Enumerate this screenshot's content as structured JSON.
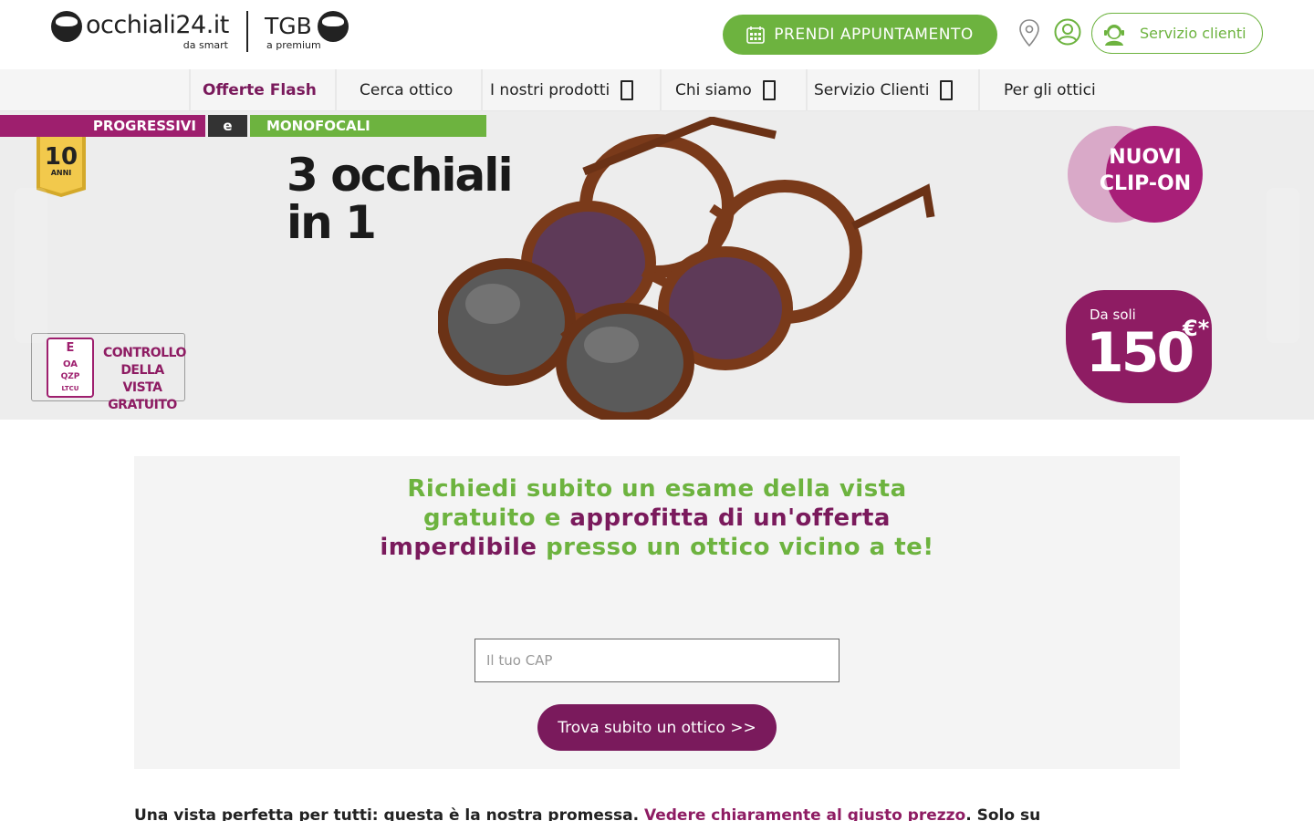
{
  "header": {
    "logo_occhiali": {
      "name": "occhiali24.it",
      "sub": "da smart"
    },
    "logo_tgb": {
      "name": "TGB",
      "sub": "a premium"
    },
    "appointment_label": "PRENDI APPUNTAMENTO",
    "service_label": "Servizio clienti",
    "accent_green": "#6db33f",
    "accent_purple": "#7a1a5c"
  },
  "nav": {
    "items": [
      {
        "label": "Offerte Flash"
      },
      {
        "label": "Cerca ottico"
      },
      {
        "label": "I nostri prodotti"
      },
      {
        "label": "Chi siamo"
      },
      {
        "label": "Servizio Clienti"
      },
      {
        "label": "Per gli ottici"
      }
    ]
  },
  "banner": {
    "pill_progressivi": "PROGRESSIVI",
    "pill_e": "e",
    "pill_monofocali": "MONOFOCALI",
    "badge_years": "10",
    "badge_anni": "ANNI",
    "headline_line1": "3 occhiali",
    "headline_line2": "in 1",
    "clipon_line1": "NUOVI",
    "clipon_line2": "CLIP-ON",
    "price_prefix": "Da soli",
    "price_value": "150",
    "price_currency": "€*",
    "controllo_line1": "CONTROLLO",
    "controllo_line2": "DELLA VISTA",
    "controllo_line3": "GRATUITO",
    "eye_chart_row1": "E",
    "eye_chart_row2": "OA",
    "eye_chart_row3": "QZP",
    "eye_chart_row4": "LTCU"
  },
  "exam": {
    "title_part1": "Richiedi subito un esame della vista gratuito e ",
    "title_part2": "approfitta di un'offerta imperdibile",
    "title_part3": " presso un ottico vicino a te!",
    "cap_placeholder": "Il tuo CAP",
    "cap_value": "",
    "find_button": "Trova subito un ottico >>"
  },
  "promise": {
    "text": "Una vista perfetta per tutti: questa è la nostra promessa. ",
    "link": "Vedere chiaramente al giusto prezzo",
    "text_after": ". Solo su"
  }
}
